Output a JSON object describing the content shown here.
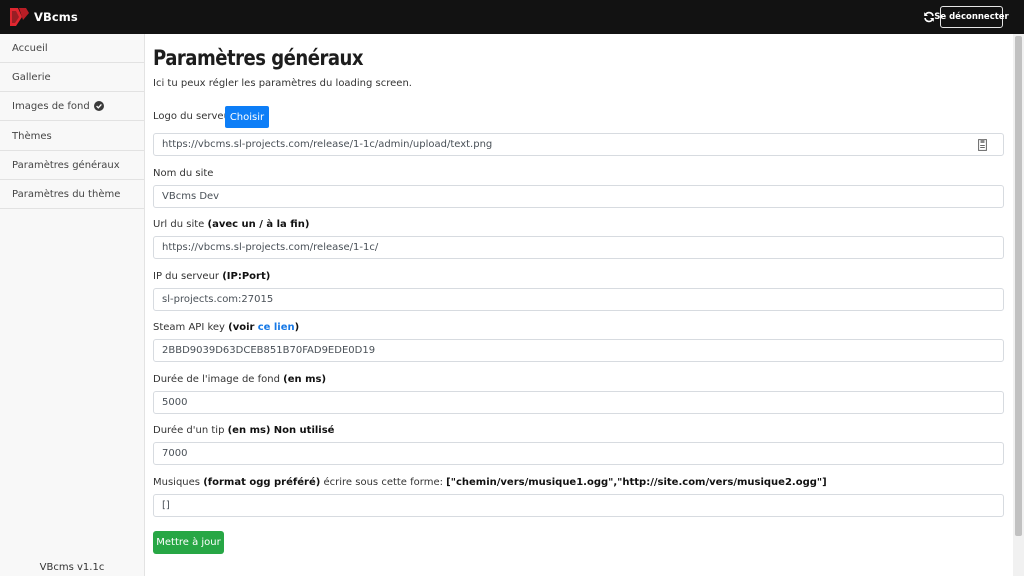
{
  "header": {
    "brand": "VBcms",
    "logout_label": "Se déconnecter"
  },
  "sidebar": {
    "items": [
      {
        "label": "Accueil"
      },
      {
        "label": "Gallerie"
      },
      {
        "label": "Images de fond"
      },
      {
        "label": "Thèmes"
      },
      {
        "label": "Paramètres généraux"
      },
      {
        "label": "Paramètres du thème"
      }
    ],
    "version": "VBcms v1.1c"
  },
  "main": {
    "title": "Paramètres généraux",
    "intro": "Ici tu peux régler les paramètres du loading screen.",
    "logo": {
      "label": "Logo du serveur",
      "choose_label": "Choisir",
      "value": "https://vbcms.sl-projects.com/release/1-1c/admin/upload/text.png"
    },
    "site_name": {
      "label": "Nom du site",
      "value": "VBcms Dev"
    },
    "site_url": {
      "label": "Url du site",
      "hint": "(avec un / à la fin)",
      "value": "https://vbcms.sl-projects.com/release/1-1c/"
    },
    "server_ip": {
      "label": "IP du serveur",
      "hint": "(IP:Port)",
      "value": "sl-projects.com:27015"
    },
    "steam_key": {
      "label": "Steam API key",
      "hint_open": "(voir",
      "link": "ce lien",
      "hint_close": ")",
      "value": "2BBD9039D63DCEB851B70FAD9EDE0D19"
    },
    "bg_duration": {
      "label": "Durée de l'image de fond",
      "hint": "(en ms)",
      "value": "5000"
    },
    "tip_duration": {
      "label": "Durée d'un tip",
      "hint": "(en ms)",
      "note": "Non utilisé",
      "value": "7000"
    },
    "music": {
      "label": "Musiques",
      "hint": "(format ogg préféré)",
      "text": "écrire sous cette forme:",
      "example": "[\"chemin/vers/musique1.ogg\",\"http://site.com/vers/musique2.ogg\"]",
      "value": "[]"
    },
    "submit_label": "Mettre à jour"
  },
  "icons": {
    "refresh": "refresh-icon",
    "verified": "check-circle-icon",
    "file": "file-icon"
  },
  "colors": {
    "topbar": "#121212",
    "brand_red": "#e0262f",
    "primary": "#0d7ef7",
    "success": "#27a745",
    "link": "#1779e6"
  }
}
